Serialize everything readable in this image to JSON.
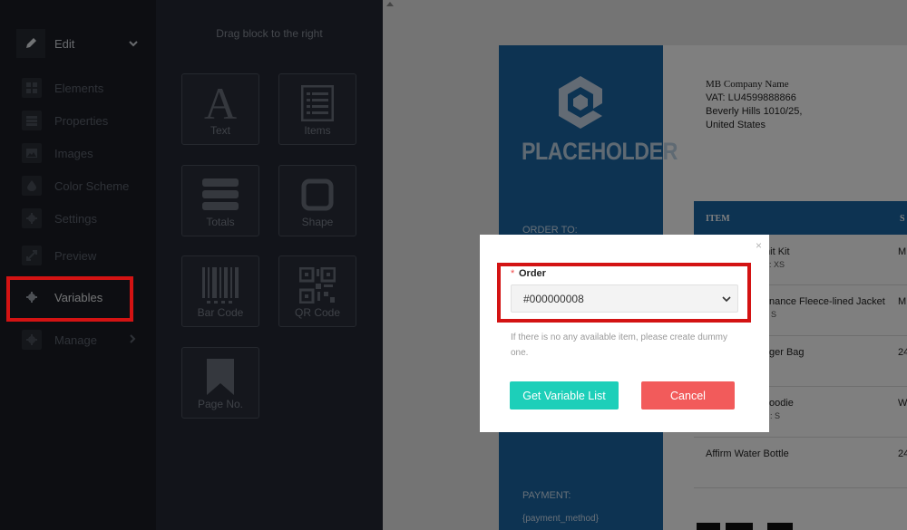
{
  "sidebar": {
    "edit_label": "Edit",
    "items": [
      {
        "label": "Elements",
        "icon": "grid-icon"
      },
      {
        "label": "Properties",
        "icon": "list-icon"
      },
      {
        "label": "Images",
        "icon": "image-icon"
      },
      {
        "label": "Color Scheme",
        "icon": "drop-icon"
      },
      {
        "label": "Settings",
        "icon": "gear-icon"
      }
    ],
    "preview_label": "Preview",
    "variables_label": "Variables",
    "manage_label": "Manage"
  },
  "blocks": {
    "title": "Drag block to the right",
    "items": [
      {
        "label": "Text",
        "icon": "text-icon"
      },
      {
        "label": "Items",
        "icon": "items-icon"
      },
      {
        "label": "Totals",
        "icon": "totals-icon"
      },
      {
        "label": "Shape",
        "icon": "shape-icon"
      },
      {
        "label": "Bar Code",
        "icon": "barcode-icon"
      },
      {
        "label": "QR Code",
        "icon": "qrcode-icon"
      },
      {
        "label": "Page No.",
        "icon": "bookmark-icon"
      }
    ]
  },
  "document": {
    "placeholder_text": "PLACEHOLDER",
    "order_to_label": "ORDER TO:",
    "payment_label": "PAYMENT:",
    "payment_value": "{payment_method}",
    "company": {
      "name": "MB Company Name",
      "vat": "VAT: LU4599888866",
      "address1": "Beverly Hills 1010/25,",
      "address2": "United States"
    },
    "table": {
      "header_item": "ITEM",
      "header_second": "S",
      "rows": [
        {
          "item": "mit Kit",
          "sub": "e: XS",
          "col2": "M"
        },
        {
          "item": "nance Fleece-lined Jacket",
          "sub": "S",
          "col2": "M"
        },
        {
          "item": "ger Bag",
          "sub": "",
          "col2": "24"
        },
        {
          "item": "oodie",
          "sub": ": S",
          "col2": "W"
        },
        {
          "item": "Affirm Water Bottle",
          "sub": "",
          "col2": "24"
        }
      ]
    }
  },
  "modal": {
    "required_mark": "*",
    "order_label": "Order",
    "order_value": "#000000008",
    "hint_text": "If there is no any available item, please create dummy one.",
    "get_button": "Get Variable List",
    "cancel_button": "Cancel",
    "close_symbol": "×"
  },
  "colors": {
    "accent_teal": "#1dcfb9",
    "cancel_red": "#f25b5b",
    "highlight_red": "#d31313",
    "doc_blue": "#1a66a5"
  }
}
